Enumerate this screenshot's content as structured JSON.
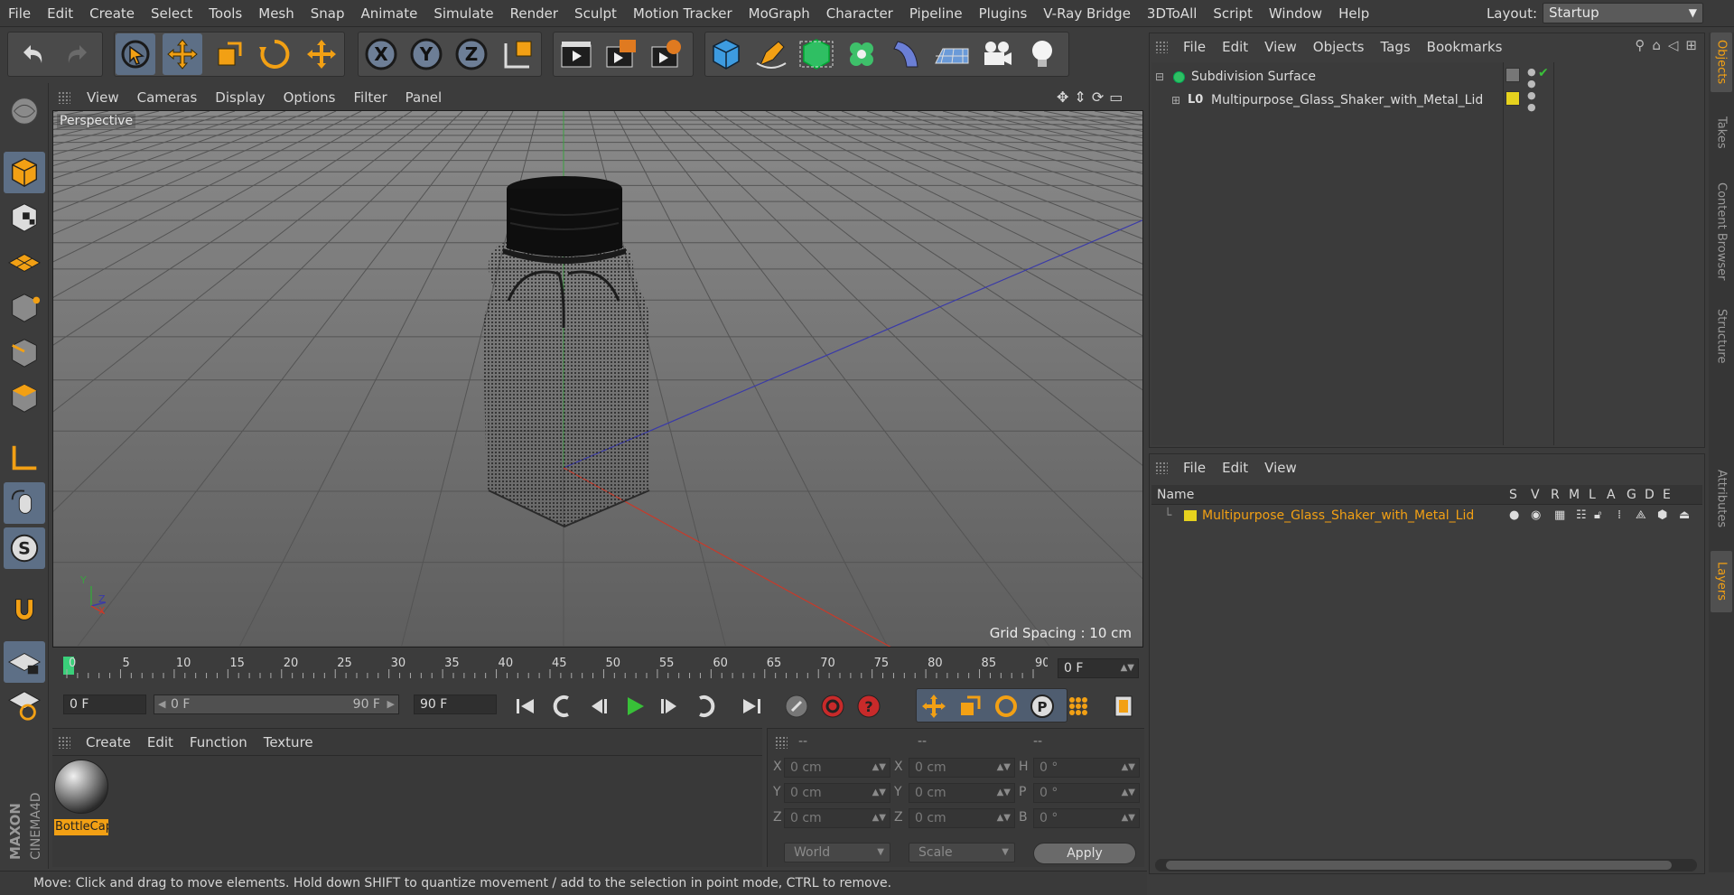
{
  "menubar": {
    "items": [
      "File",
      "Edit",
      "Create",
      "Select",
      "Tools",
      "Mesh",
      "Snap",
      "Animate",
      "Simulate",
      "Render",
      "Sculpt",
      "Motion Tracker",
      "MoGraph",
      "Character",
      "Pipeline",
      "Plugins",
      "V-Ray Bridge",
      "3DToAll",
      "Script",
      "Window",
      "Help"
    ],
    "layout_label": "Layout:",
    "layout_value": "Startup"
  },
  "toolbar": {
    "icons": [
      "undo-icon",
      "redo-icon",
      "live-selection-icon",
      "move-icon",
      "scale-icon",
      "rotate-icon",
      "move-plus-icon",
      "x-axis-icon",
      "y-axis-icon",
      "z-axis-icon",
      "coordinate-system-icon",
      "render-view-icon",
      "render-picture-viewer-icon",
      "render-settings-icon",
      "cube-icon",
      "pen-icon",
      "subdivision-icon",
      "cloner-icon",
      "deformer-icon",
      "floor-icon",
      "camera-icon",
      "light-icon"
    ],
    "axis_labels": [
      "X",
      "Y",
      "Z"
    ]
  },
  "viewport": {
    "menu": [
      "View",
      "Cameras",
      "Display",
      "Options",
      "Filter",
      "Panel"
    ],
    "label": "Perspective",
    "grid_spacing": "Grid Spacing : 10 cm",
    "axis_x": "X",
    "axis_y": "Y",
    "axis_z": "Z"
  },
  "timeline": {
    "ticks": [
      "0",
      "5",
      "10",
      "15",
      "20",
      "25",
      "30",
      "35",
      "40",
      "45",
      "50",
      "55",
      "60",
      "65",
      "70",
      "75",
      "80",
      "85",
      "90"
    ],
    "current_frame": "0 F"
  },
  "transport": {
    "start_frame": "0 F",
    "range_start": "0 F",
    "range_end": "90 F",
    "end_frame": "90 F"
  },
  "material_manager": {
    "menu": [
      "Create",
      "Edit",
      "Function",
      "Texture"
    ],
    "material_name": "BottleCap"
  },
  "coordinates": {
    "headers": [
      "--",
      "--",
      "--"
    ],
    "rows": [
      {
        "l1": "X",
        "v1": "0 cm",
        "l2": "X",
        "v2": "0 cm",
        "l3": "H",
        "v3": "0 °"
      },
      {
        "l1": "Y",
        "v1": "0 cm",
        "l2": "Y",
        "v2": "0 cm",
        "l3": "P",
        "v3": "0 °"
      },
      {
        "l1": "Z",
        "v1": "0 cm",
        "l2": "Z",
        "v2": "0 cm",
        "l3": "B",
        "v3": "0 °"
      }
    ],
    "mode_world": "World",
    "mode_scale": "Scale",
    "apply": "Apply"
  },
  "status": "Move: Click and drag to move elements. Hold down SHIFT to quantize movement / add to the selection in point mode, CTRL to remove.",
  "object_manager": {
    "menu": [
      "File",
      "Edit",
      "View",
      "Objects",
      "Tags",
      "Bookmarks"
    ],
    "objects": [
      {
        "name": "Subdivision Surface"
      },
      {
        "name": "Multipurpose_Glass_Shaker_with_Metal_Lid"
      }
    ]
  },
  "layer_manager": {
    "menu": [
      "File",
      "Edit",
      "View"
    ],
    "columns": [
      "Name",
      "S",
      "V",
      "R",
      "M",
      "L",
      "A",
      "G",
      "D",
      "E"
    ],
    "layer_name": "Multipurpose_Glass_Shaker_with_Metal_Lid",
    "layer_color": "#e6d21e"
  },
  "side_tabs": [
    "Objects",
    "Takes",
    "Content Browser",
    "Structure",
    "Attributes",
    "Layers"
  ],
  "colors": {
    "accent": "#f2a014",
    "active_blue": "#5d6f86",
    "axis_x": "#c83a2a",
    "axis_y": "#3aa040",
    "axis_z": "#3a3aa8"
  }
}
